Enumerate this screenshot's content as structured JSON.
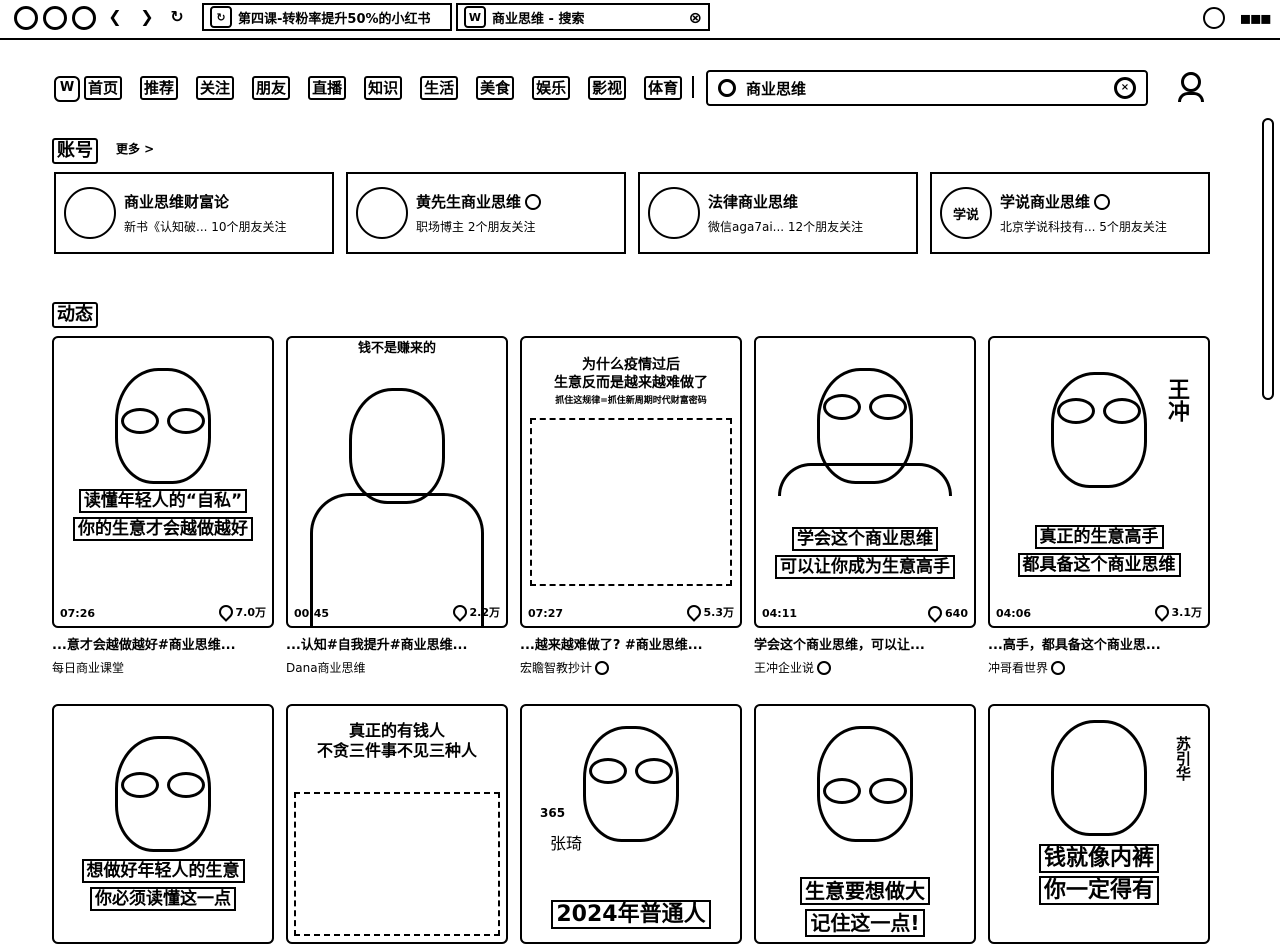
{
  "browser": {
    "tabs": [
      {
        "title": "第四课-转粉率提升50%的小红书",
        "icon": "↻"
      },
      {
        "title": "商业思维 - 搜索",
        "icon": "W",
        "close": "⊗"
      }
    ]
  },
  "nav": {
    "logo": "W",
    "items": [
      "首页",
      "推荐",
      "关注",
      "朋友",
      "直播",
      "知识",
      "生活",
      "美食",
      "娱乐",
      "影视",
      "体育"
    ]
  },
  "search": {
    "value": "商业思维"
  },
  "accounts_section": {
    "title": "账号",
    "more": "更多 >",
    "cards": [
      {
        "avatar": "",
        "name": "商业思维财富论",
        "meta": "新书《认知破... 10个朋友关注",
        "verified": false
      },
      {
        "avatar": "",
        "name": "黄先生商业思维",
        "meta": "职场博主 2个朋友关注",
        "verified": true
      },
      {
        "avatar": "",
        "name": "法律商业思维",
        "meta": "微信aga7ai... 12个朋友关注",
        "verified": false
      },
      {
        "avatar": "学说",
        "name": "学说商业思维",
        "meta": "北京学说科技有... 5个朋友关注",
        "verified": true
      }
    ]
  },
  "feed_section": {
    "title": "动态",
    "row1": [
      {
        "overlay": [
          "读懂年轻人的“自私”",
          "你的生意才会越做越好"
        ],
        "top_text": [],
        "duration": "07:26",
        "likes": "7.0万",
        "caption": "...意才会越做越好#商业思维...",
        "author": "每日商业课堂",
        "verified": false
      },
      {
        "overlay": [],
        "top_text": [
          "钱不是赚来的"
        ],
        "duration": "00:45",
        "likes": "2.2万",
        "caption": "...认知#自我提升#商业思维...",
        "author": "Dana商业思维",
        "verified": false
      },
      {
        "overlay": [],
        "top_text": [
          "为什么疫情过后",
          "生意反而是越来越难做了",
          "抓住这规律=抓住新周期时代财富密码"
        ],
        "duration": "07:27",
        "likes": "5.3万",
        "caption": "...越来越难做了? #商业思维...",
        "author": "宏瞻智教抄计",
        "verified": true
      },
      {
        "overlay": [
          "学会这个商业思维",
          "可以让你成为生意高手"
        ],
        "top_text": [],
        "duration": "04:11",
        "likes": "640",
        "caption": "学会这个商业思维，可以让...",
        "author": "王冲企业说",
        "verified": true
      },
      {
        "overlay": [
          "真正的生意高手",
          "都具备这个商业思维"
        ],
        "top_text": [
          "王冲"
        ],
        "duration": "04:06",
        "likes": "3.1万",
        "caption": "...高手，都具备这个商业思...",
        "author": "冲哥看世界",
        "verified": true
      }
    ],
    "row2": [
      {
        "overlay": [
          "想做好年轻人的生意",
          "你必须读懂这一点"
        ],
        "top_text": []
      },
      {
        "overlay": [],
        "top_text": [
          "真正的有钱人",
          "不贪三件事不见三种人"
        ]
      },
      {
        "overlay": [
          "2024年普通人"
        ],
        "top_text": [
          "365",
          "张琦"
        ]
      },
      {
        "overlay": [
          "生意要想做大",
          "记住这一点!"
        ],
        "top_text": []
      },
      {
        "overlay": [
          "钱就像内裤",
          "你一定得有"
        ],
        "top_text": [
          "苏引华"
        ]
      }
    ]
  }
}
